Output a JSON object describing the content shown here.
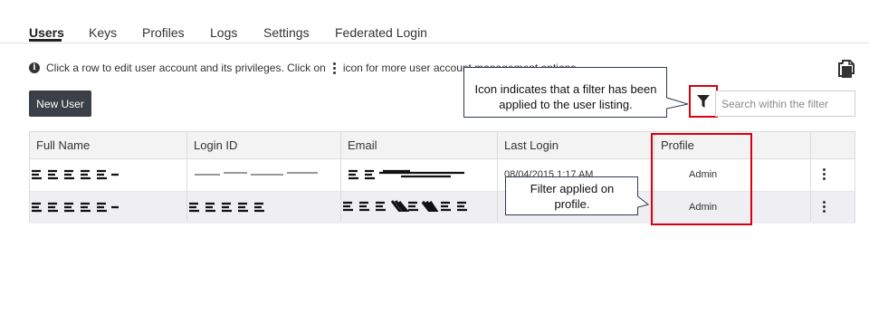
{
  "tabs": [
    {
      "label": "Users"
    },
    {
      "label": "Keys"
    },
    {
      "label": "Profiles"
    },
    {
      "label": "Logs"
    },
    {
      "label": "Settings"
    },
    {
      "label": "Federated Login"
    }
  ],
  "info": {
    "text_before": "Click a row to edit user account and its privileges. Click on",
    "text_after": "icon for more user account management options."
  },
  "buttons": {
    "new_user": "New User"
  },
  "search": {
    "placeholder": "Search within the filter"
  },
  "table": {
    "headers": [
      "Full Name",
      "Login ID",
      "Email",
      "Last Login",
      "Profile"
    ],
    "rows": [
      {
        "last_login": "08/04/2015 1:17 AM",
        "profile": "Admin"
      },
      {
        "last_login": "",
        "profile": "Admin"
      }
    ]
  },
  "callouts": {
    "filter": "Icon indicates that a filter has been applied to the user listing.",
    "profile": "Filter applied on profile."
  },
  "colors": {
    "accent_red": "#d6000f",
    "button_bg": "#3b3f47"
  },
  "icons": [
    "info-icon",
    "kebab-icon",
    "copy-icon",
    "filter-icon"
  ]
}
